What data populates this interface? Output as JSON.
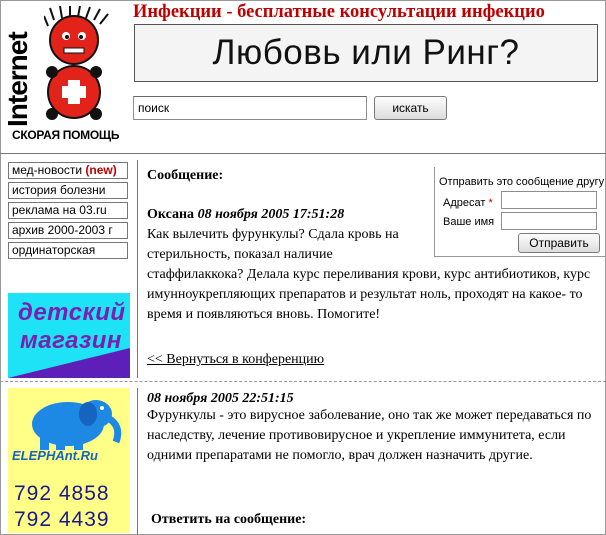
{
  "logo": {
    "word": "Internet",
    "caption": "СКОРАЯ ПОМОЩЬ"
  },
  "site_title": "Инфекции - бесплатные консультации инфекцио",
  "banner": {
    "text": "Любовь или Ринг?"
  },
  "search": {
    "value": "поиск",
    "button": "искать"
  },
  "nav": {
    "items": [
      {
        "label": "мед-новости",
        "badge": "(new)"
      },
      {
        "label": "история болезни"
      },
      {
        "label": "реклама на 03.ru"
      },
      {
        "label": "архив 2000-2003 г"
      },
      {
        "label": "ординаторская"
      }
    ]
  },
  "ads": {
    "kids": {
      "line1": "детский",
      "line2": "магазин"
    },
    "elephant": {
      "brand": "ELEPHAnt.Ru",
      "phone1": "792 4858",
      "phone2": "792 4439"
    }
  },
  "message": {
    "label": "Сообщение:",
    "author": "Оксана",
    "date": "08 ноября 2005 17:51:28",
    "body": "Как вылечить фурункулы? Сдала кровь на стерильность, показал наличие стаффилаккока? Делала курс переливания крови, курс антибиотиков, курс имунноукрепляющих препаратов и результат ноль, проходят на какое- то время и появляються вновь. Помогите!",
    "back_link": "<< Вернуться в конференцию"
  },
  "send_form": {
    "title": "Отправить это сообщение другу",
    "recipient_label": "Адресат",
    "required_mark": "*",
    "name_label": "Ваше имя",
    "button": "Отправить"
  },
  "reply": {
    "date": "08 ноября 2005 22:51:15",
    "body": "Фурункулы - это вирусное заболевание, оно так же может передаваться по наследству, лечение противовирусное и укрепление иммунитета, если одними препаратами не помогло, врач должен назначить другие."
  },
  "reply_form": {
    "label": "Ответить на сообщение:"
  },
  "colors": {
    "title_red": "#c00000",
    "kids_bg": "#1ee3f6",
    "kids_purple": "#5d1fb8",
    "eleph_bg": "#ffff88",
    "eleph_blue": "#1565c0"
  }
}
